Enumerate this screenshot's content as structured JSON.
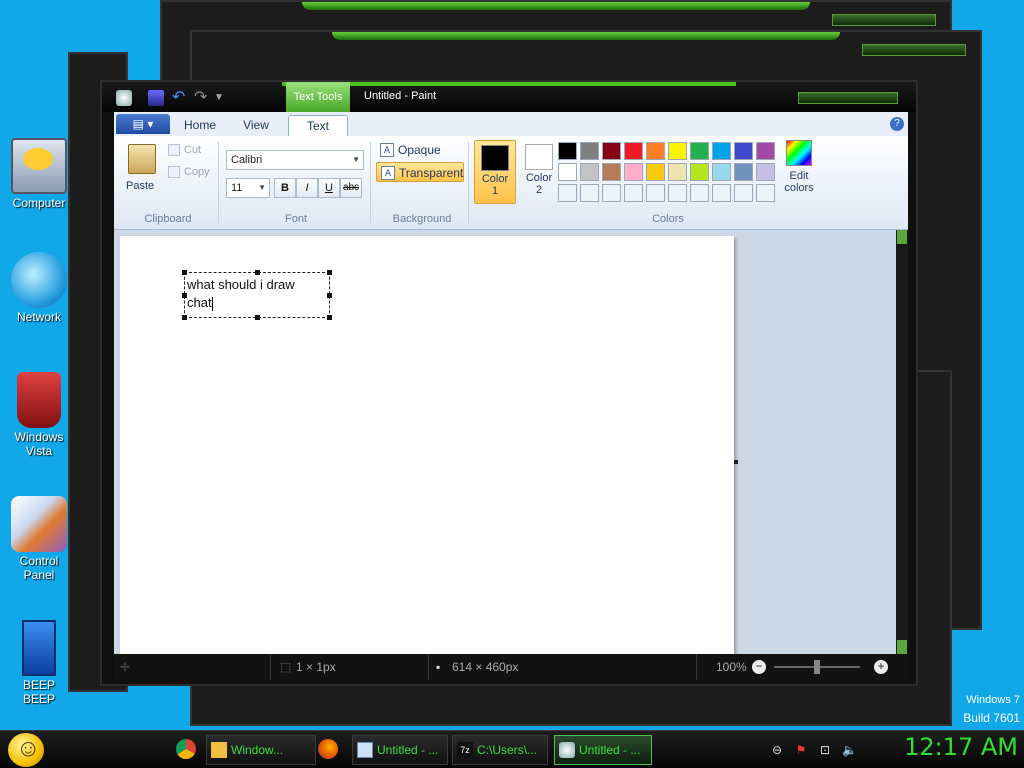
{
  "desktop": {
    "icons": [
      {
        "label": "Computer"
      },
      {
        "label": "Network"
      },
      {
        "label": "Windows Vista"
      },
      {
        "label": "Control Panel"
      },
      {
        "label": "BEEP BEEP"
      }
    ],
    "watermark": {
      "line1": "Windows 7",
      "line2": "Build 7601"
    }
  },
  "paint": {
    "contextual_tab": "Text Tools",
    "title": "Untitled - Paint",
    "tabs": {
      "home": "Home",
      "view": "View",
      "text": "Text"
    },
    "clipboard": {
      "paste": "Paste",
      "cut": "Cut",
      "copy": "Copy",
      "group": "Clipboard"
    },
    "font": {
      "family": "Calibri",
      "size": "11",
      "bold": "B",
      "italic": "I",
      "underline": "U",
      "strike": "abc",
      "group": "Font"
    },
    "background": {
      "opaque": "Opaque",
      "transparent": "Transparent",
      "group": "Background"
    },
    "colors": {
      "color1_label": "Color 1",
      "color2_label": "Color 2",
      "color1": "#000000",
      "color2": "#ffffff",
      "edit": "Edit colors",
      "group": "Colors",
      "palette_row1": [
        "#000000",
        "#7f7f7f",
        "#880015",
        "#ed1c24",
        "#ff7f27",
        "#fff200",
        "#22b14c",
        "#00a2e8",
        "#3f48cc",
        "#a349a4"
      ],
      "palette_row2": [
        "#ffffff",
        "#c3c3c3",
        "#b97a57",
        "#ffaec9",
        "#ffc90e",
        "#efe4b0",
        "#b5e61d",
        "#99d9ea",
        "#7092be",
        "#c8bfe7"
      ]
    },
    "canvas": {
      "text_line1": "what should i draw",
      "text_line2": "chat"
    },
    "status": {
      "selection": "1 × 1px",
      "canvas_size": "614 × 460px",
      "zoom": "100%"
    }
  },
  "taskbar": {
    "buttons": [
      {
        "label": "Window..."
      },
      {
        "label": "Untitled - ..."
      },
      {
        "label": "C:\\Users\\..."
      },
      {
        "label": "Untitled - ..."
      }
    ],
    "clock": "12:17 AM"
  }
}
